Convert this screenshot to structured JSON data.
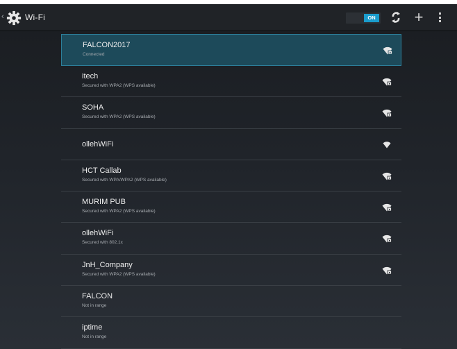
{
  "header": {
    "title": "Wi-Fi",
    "toggle_label": "ON",
    "icons": {
      "settings": "settings-gear-icon",
      "wps": "wps-push-icon",
      "add": "add-network-icon",
      "overflow": "overflow-menu-icon"
    }
  },
  "colors": {
    "accent": "#1a9ccc",
    "selected_row": "#1d4a5a",
    "background": "#20242a"
  },
  "networks": [
    {
      "ssid": "FALCON2017",
      "status": "Connected",
      "signal_icon": "wifi-secured-icon"
    },
    {
      "ssid": "itech",
      "status": "Secured with WPA2 (WPS available)",
      "signal_icon": "wifi-secured-icon"
    },
    {
      "ssid": "SOHA",
      "status": "Secured with WPA2 (WPS available)",
      "signal_icon": "wifi-secured-icon"
    },
    {
      "ssid": "ollehWiFi",
      "status": "",
      "signal_icon": "wifi-open-icon"
    },
    {
      "ssid": "HCT Callab",
      "status": "Secured with WPA/WPA2 (WPS available)",
      "signal_icon": "wifi-secured-icon"
    },
    {
      "ssid": "MURIM PUB",
      "status": "Secured with WPA2 (WPS available)",
      "signal_icon": "wifi-secured-icon"
    },
    {
      "ssid": "ollehWiFi",
      "status": "Secured with 802.1x",
      "signal_icon": "wifi-secured-icon"
    },
    {
      "ssid": "JnH_Company",
      "status": "Secured with WPA2 (WPS available)",
      "signal_icon": "wifi-secured-icon"
    },
    {
      "ssid": "FALCON",
      "status": "Not in range",
      "signal_icon": ""
    },
    {
      "ssid": "iptime",
      "status": "Not in range",
      "signal_icon": ""
    }
  ]
}
